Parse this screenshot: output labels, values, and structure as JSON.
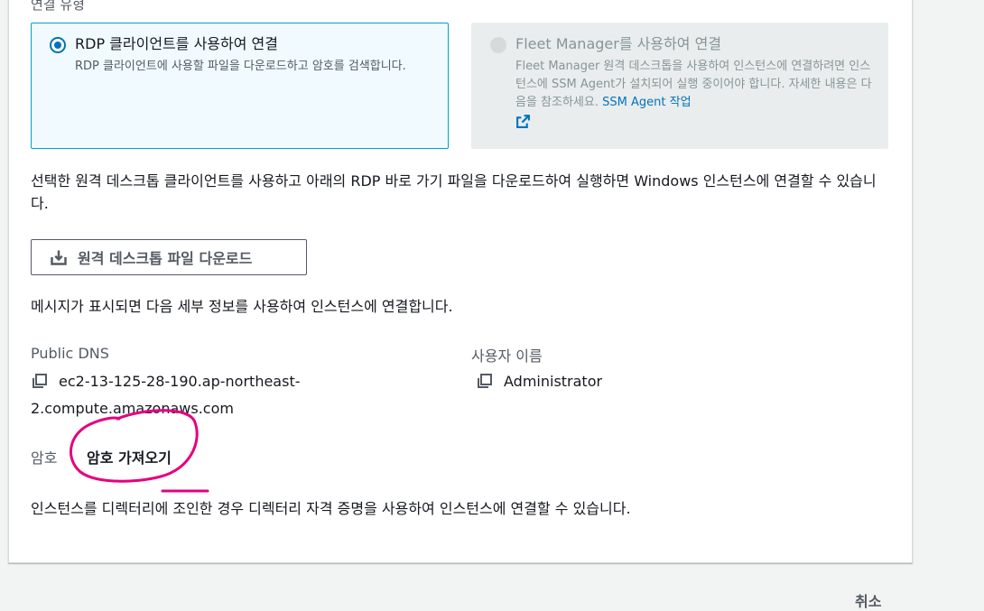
{
  "connection_type": {
    "label": "연결 유형",
    "rdp_option": {
      "title": "RDP 클라이언트를 사용하여 연결",
      "description": "RDP 클라이언트에 사용할 파일을 다운로드하고 암호를 검색합니다.",
      "selected": true
    },
    "fleet_option": {
      "title": "Fleet Manager를 사용하여 연결",
      "description": "Fleet Manager 원격 데스크톱을 사용하여 인스턴스에 연결하려면 인스턴스에 SSM Agent가 설치되어 실행 중이어야 합니다. 자세한 내용은 다음을 참조하세요.",
      "link_text": "SSM Agent 작업",
      "disabled": true
    }
  },
  "instructions": "선택한 원격 데스크톱 클라이언트를 사용하고 아래의 RDP 바로 가기 파일을 다운로드하여 실행하면 Windows 인스턴스에 연결할 수 있습니다.",
  "download_button": {
    "label": "원격 데스크톱 파일 다운로드",
    "icon": "download-icon"
  },
  "prompt_text": "메시지가 표시되면 다음 세부 정보를 사용하여 인스턴스에 연결합니다.",
  "public_dns": {
    "label": "Public DNS",
    "value_line1": "ec2-13-125-28-190.ap-northeast-",
    "value_line2": "2.compute.amazonaws.com"
  },
  "username": {
    "label": "사용자 이름",
    "value": "Administrator"
  },
  "password": {
    "label": "암호",
    "link_text": "암호 가져오기"
  },
  "directory_note": "인스턴스를 디렉터리에 조인한 경우 디렉터리 자격 증명을 사용하여 인스턴스에 연결할 수 있습니다.",
  "footer": {
    "cancel_label": "취소"
  },
  "colors": {
    "accent": "#0073bb",
    "selected_border": "#00a1c9",
    "annotation": "#e6007e"
  }
}
